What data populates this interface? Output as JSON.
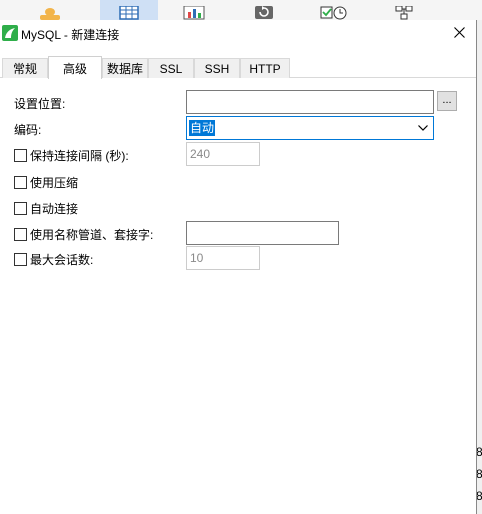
{
  "dialog": {
    "title": "MySQL - 新建连接",
    "close_glyph": "✕"
  },
  "tabs": [
    {
      "label": "常规",
      "selected": false
    },
    {
      "label": "高级",
      "selected": true
    },
    {
      "label": "数据库",
      "selected": false
    },
    {
      "label": "SSL",
      "selected": false
    },
    {
      "label": "SSH",
      "selected": false
    },
    {
      "label": "HTTP",
      "selected": false
    }
  ],
  "form": {
    "location_label": "设置位置:",
    "location_value": "",
    "browse_label": "...",
    "encoding_label": "编码:",
    "encoding_value": "自动",
    "keepalive_label": "保持连接间隔 (秒):",
    "keepalive_value": "240",
    "compression_label": "使用压缩",
    "autoconnect_label": "自动连接",
    "named_pipe_label": "使用名称管道、套接字:",
    "named_pipe_value": "",
    "max_sessions_label": "最大会话数:",
    "max_sessions_value": "10"
  },
  "background": {
    "right_edge_glyphs": [
      "8",
      "8",
      "8"
    ]
  },
  "colors": {
    "accent": "#0078d7",
    "toolbar_active": "#cfe0f5",
    "logo_green": "#2fae4a"
  },
  "icons": {
    "toolbar": [
      "user-icon",
      "table-icon",
      "chart-icon",
      "backup-icon",
      "schedule-icon",
      "model-icon"
    ],
    "dialog": [
      "mysql-logo-icon",
      "close-icon",
      "chevron-down-icon"
    ]
  }
}
